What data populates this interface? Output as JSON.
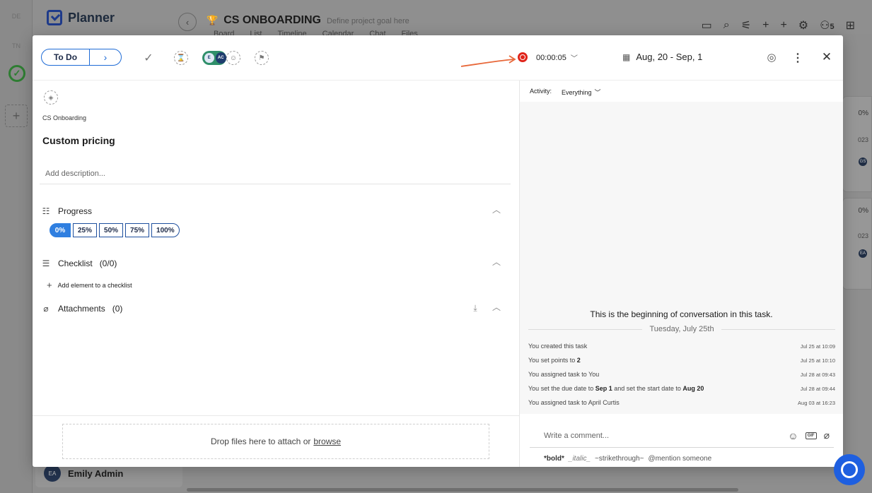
{
  "background": {
    "rail_chips": [
      "DE",
      "TN"
    ],
    "brand": "Planner",
    "project": {
      "name": "CS ONBOARDING",
      "goal": "Define project goal here"
    },
    "tabs": [
      "Board",
      "List",
      "Timeline",
      "Calendar",
      "Chat",
      "Files"
    ],
    "member_count": "5",
    "cards": [
      {
        "pct": "0%",
        "year": "023",
        "avatar": "GS"
      },
      {
        "pct": "0%",
        "year": "023",
        "avatar": "EA"
      }
    ],
    "user": {
      "initials": "EA",
      "name": "Emily Admin"
    }
  },
  "modal": {
    "header": {
      "status": "To Do",
      "assignees": [
        "E",
        "AC"
      ],
      "timer": "00:00:05",
      "date_range": "Aug, 20 - Sep, 1"
    },
    "left": {
      "project_label": "CS Onboarding",
      "title": "Custom pricing",
      "description_placeholder": "Add description...",
      "progress": {
        "label": "Progress",
        "options": [
          "0%",
          "25%",
          "50%",
          "75%",
          "100%"
        ],
        "selected": "0%"
      },
      "checklist": {
        "label": "Checklist",
        "count": "(0/0)",
        "add_label": "Add element to a checklist"
      },
      "attachments": {
        "label": "Attachments",
        "count": "(0)"
      },
      "dropzone": {
        "text": "Drop files here to attach or",
        "link": "browse"
      }
    },
    "right": {
      "activity_label": "Activity:",
      "activity_filter": "Everything",
      "conversation_start": "This is the beginning of conversation in this task.",
      "day": "Tuesday, July 25th",
      "feed": [
        {
          "pre": "You created this task",
          "b1": "",
          "mid": "",
          "b2": "",
          "when": "Jul 25 at 10:09"
        },
        {
          "pre": "You set points to ",
          "b1": "2",
          "mid": "",
          "b2": "",
          "when": "Jul 25 at 10:10"
        },
        {
          "pre": "You assigned task to You",
          "b1": "",
          "mid": "",
          "b2": "",
          "when": "Jul 28 at 09:43"
        },
        {
          "pre": "You set the due date to ",
          "b1": "Sep 1",
          "mid": " and set the start date to ",
          "b2": "Aug 20",
          "when": "Jul 28 at 09:44"
        },
        {
          "pre": "You assigned task to April Curtis",
          "b1": "",
          "mid": "",
          "b2": "",
          "when": "Aug 03 at 16:23"
        }
      ],
      "comment_placeholder": "Write a comment...",
      "format_hint": {
        "bold": "*bold*",
        "italic": "_italic_",
        "strike": "~strikethrough~",
        "mention": "@mention someone"
      }
    }
  },
  "colors": {
    "accent": "#1e6bd6",
    "record": "#e0241a",
    "arrow": "#e8683a",
    "help": "#1e5fe0"
  }
}
